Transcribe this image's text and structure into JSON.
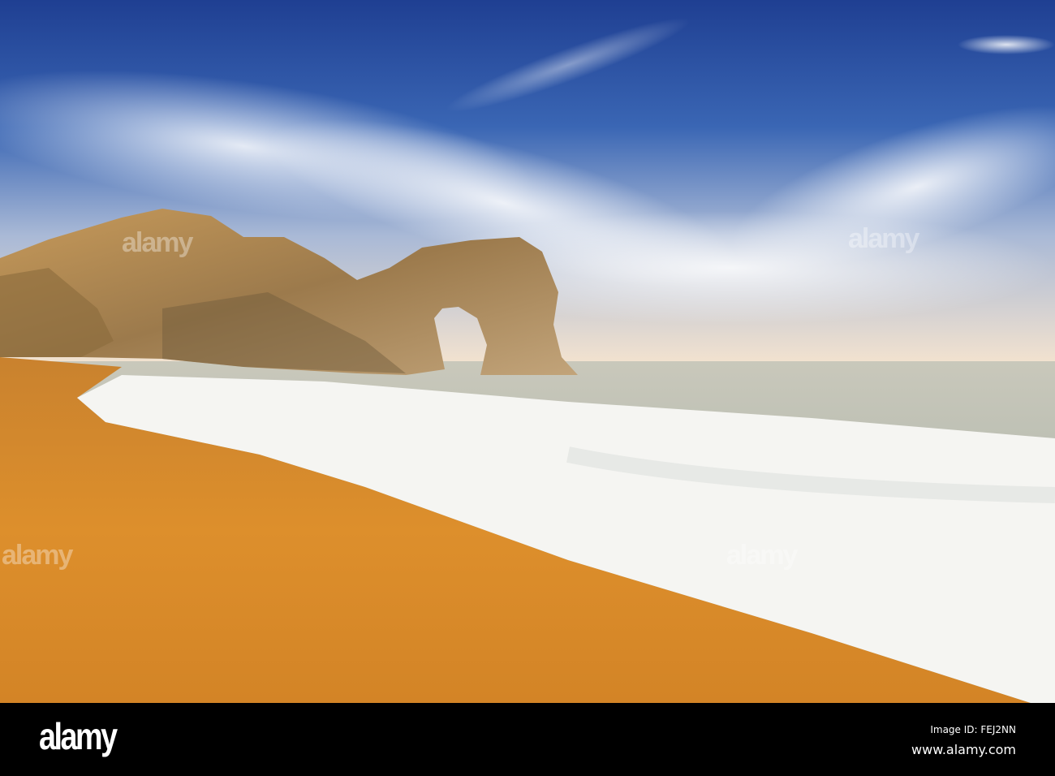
{
  "photo": {
    "subject": "Durdle Door sea arch and beach"
  },
  "watermark": "alamy",
  "footer": {
    "logo": "alamy",
    "image_id": "Image ID: FEJ2NN",
    "website": "www.alamy.com"
  },
  "colors": {
    "sky_top": "#234a9c",
    "horizon": "#f2e2cf",
    "sea": "#b8bcae",
    "foam": "#f6f6f4",
    "sand": "#d98a2c",
    "rock": "#b08a55",
    "footer": "#000000"
  }
}
